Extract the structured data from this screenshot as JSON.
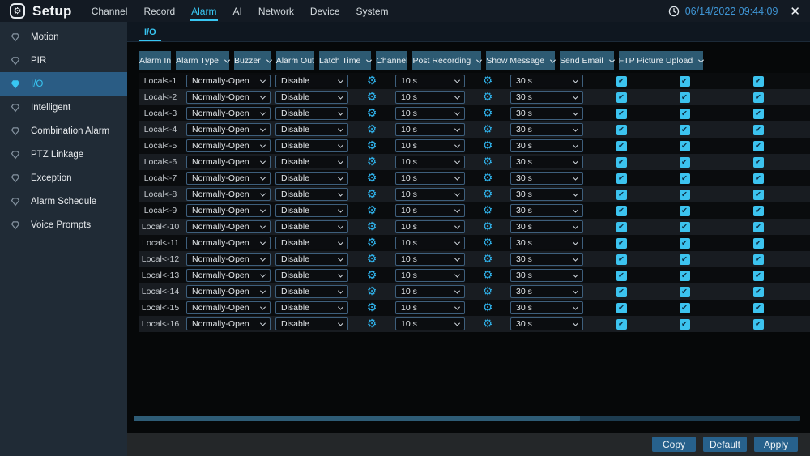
{
  "topbar": {
    "app_title": "Setup",
    "menu": [
      {
        "label": "Channel"
      },
      {
        "label": "Record"
      },
      {
        "label": "Alarm",
        "active": true
      },
      {
        "label": "AI"
      },
      {
        "label": "Network"
      },
      {
        "label": "Device"
      },
      {
        "label": "System"
      }
    ],
    "datetime": "06/14/2022 09:44:09",
    "close_label": "✕"
  },
  "sidebar": {
    "items": [
      {
        "label": "Motion"
      },
      {
        "label": "PIR"
      },
      {
        "label": "I/O",
        "active": true
      },
      {
        "label": "Intelligent"
      },
      {
        "label": "Combination Alarm"
      },
      {
        "label": "PTZ Linkage"
      },
      {
        "label": "Exception"
      },
      {
        "label": "Alarm Schedule"
      },
      {
        "label": "Voice Prompts"
      }
    ]
  },
  "main": {
    "tab": "I/O",
    "table": {
      "columns": [
        {
          "label": "Alarm In",
          "dropdown": false
        },
        {
          "label": "Alarm Type",
          "dropdown": true
        },
        {
          "label": "Buzzer",
          "dropdown": true
        },
        {
          "label": "Alarm Out",
          "dropdown": false
        },
        {
          "label": "Latch Time",
          "dropdown": true
        },
        {
          "label": "Channel",
          "dropdown": false
        },
        {
          "label": "Post Recording",
          "dropdown": true
        },
        {
          "label": "Show Message",
          "dropdown": true
        },
        {
          "label": "Send Email",
          "dropdown": true
        },
        {
          "label": "FTP Picture Upload",
          "dropdown": true
        }
      ],
      "rows": [
        {
          "alarm_in": "Local<-1",
          "alarm_type": "Normally-Open",
          "buzzer": "Disable",
          "latch_time": "10 s",
          "post_recording": "30 s",
          "show_message": true,
          "send_email": true,
          "ftp_picture_upload": true
        },
        {
          "alarm_in": "Local<-2",
          "alarm_type": "Normally-Open",
          "buzzer": "Disable",
          "latch_time": "10 s",
          "post_recording": "30 s",
          "show_message": true,
          "send_email": true,
          "ftp_picture_upload": true
        },
        {
          "alarm_in": "Local<-3",
          "alarm_type": "Normally-Open",
          "buzzer": "Disable",
          "latch_time": "10 s",
          "post_recording": "30 s",
          "show_message": true,
          "send_email": true,
          "ftp_picture_upload": true
        },
        {
          "alarm_in": "Local<-4",
          "alarm_type": "Normally-Open",
          "buzzer": "Disable",
          "latch_time": "10 s",
          "post_recording": "30 s",
          "show_message": true,
          "send_email": true,
          "ftp_picture_upload": true
        },
        {
          "alarm_in": "Local<-5",
          "alarm_type": "Normally-Open",
          "buzzer": "Disable",
          "latch_time": "10 s",
          "post_recording": "30 s",
          "show_message": true,
          "send_email": true,
          "ftp_picture_upload": true
        },
        {
          "alarm_in": "Local<-6",
          "alarm_type": "Normally-Open",
          "buzzer": "Disable",
          "latch_time": "10 s",
          "post_recording": "30 s",
          "show_message": true,
          "send_email": true,
          "ftp_picture_upload": true
        },
        {
          "alarm_in": "Local<-7",
          "alarm_type": "Normally-Open",
          "buzzer": "Disable",
          "latch_time": "10 s",
          "post_recording": "30 s",
          "show_message": true,
          "send_email": true,
          "ftp_picture_upload": true
        },
        {
          "alarm_in": "Local<-8",
          "alarm_type": "Normally-Open",
          "buzzer": "Disable",
          "latch_time": "10 s",
          "post_recording": "30 s",
          "show_message": true,
          "send_email": true,
          "ftp_picture_upload": true
        },
        {
          "alarm_in": "Local<-9",
          "alarm_type": "Normally-Open",
          "buzzer": "Disable",
          "latch_time": "10 s",
          "post_recording": "30 s",
          "show_message": true,
          "send_email": true,
          "ftp_picture_upload": true
        },
        {
          "alarm_in": "Local<-10",
          "alarm_type": "Normally-Open",
          "buzzer": "Disable",
          "latch_time": "10 s",
          "post_recording": "30 s",
          "show_message": true,
          "send_email": true,
          "ftp_picture_upload": true
        },
        {
          "alarm_in": "Local<-11",
          "alarm_type": "Normally-Open",
          "buzzer": "Disable",
          "latch_time": "10 s",
          "post_recording": "30 s",
          "show_message": true,
          "send_email": true,
          "ftp_picture_upload": true
        },
        {
          "alarm_in": "Local<-12",
          "alarm_type": "Normally-Open",
          "buzzer": "Disable",
          "latch_time": "10 s",
          "post_recording": "30 s",
          "show_message": true,
          "send_email": true,
          "ftp_picture_upload": true
        },
        {
          "alarm_in": "Local<-13",
          "alarm_type": "Normally-Open",
          "buzzer": "Disable",
          "latch_time": "10 s",
          "post_recording": "30 s",
          "show_message": true,
          "send_email": true,
          "ftp_picture_upload": true
        },
        {
          "alarm_in": "Local<-14",
          "alarm_type": "Normally-Open",
          "buzzer": "Disable",
          "latch_time": "10 s",
          "post_recording": "30 s",
          "show_message": true,
          "send_email": true,
          "ftp_picture_upload": true
        },
        {
          "alarm_in": "Local<-15",
          "alarm_type": "Normally-Open",
          "buzzer": "Disable",
          "latch_time": "10 s",
          "post_recording": "30 s",
          "show_message": true,
          "send_email": true,
          "ftp_picture_upload": true
        },
        {
          "alarm_in": "Local<-16",
          "alarm_type": "Normally-Open",
          "buzzer": "Disable",
          "latch_time": "10 s",
          "post_recording": "30 s",
          "show_message": true,
          "send_email": true,
          "ftp_picture_upload": true
        }
      ]
    },
    "buttons": [
      {
        "label": "Copy"
      },
      {
        "label": "Default"
      },
      {
        "label": "Apply"
      }
    ]
  },
  "colors": {
    "accent": "#38c6f2",
    "header-cell": "#2d5a72",
    "active-item": "#2a5c84",
    "button": "#27618c",
    "checkbox": "#3cc3ef",
    "datetime": "#3f96d6"
  }
}
